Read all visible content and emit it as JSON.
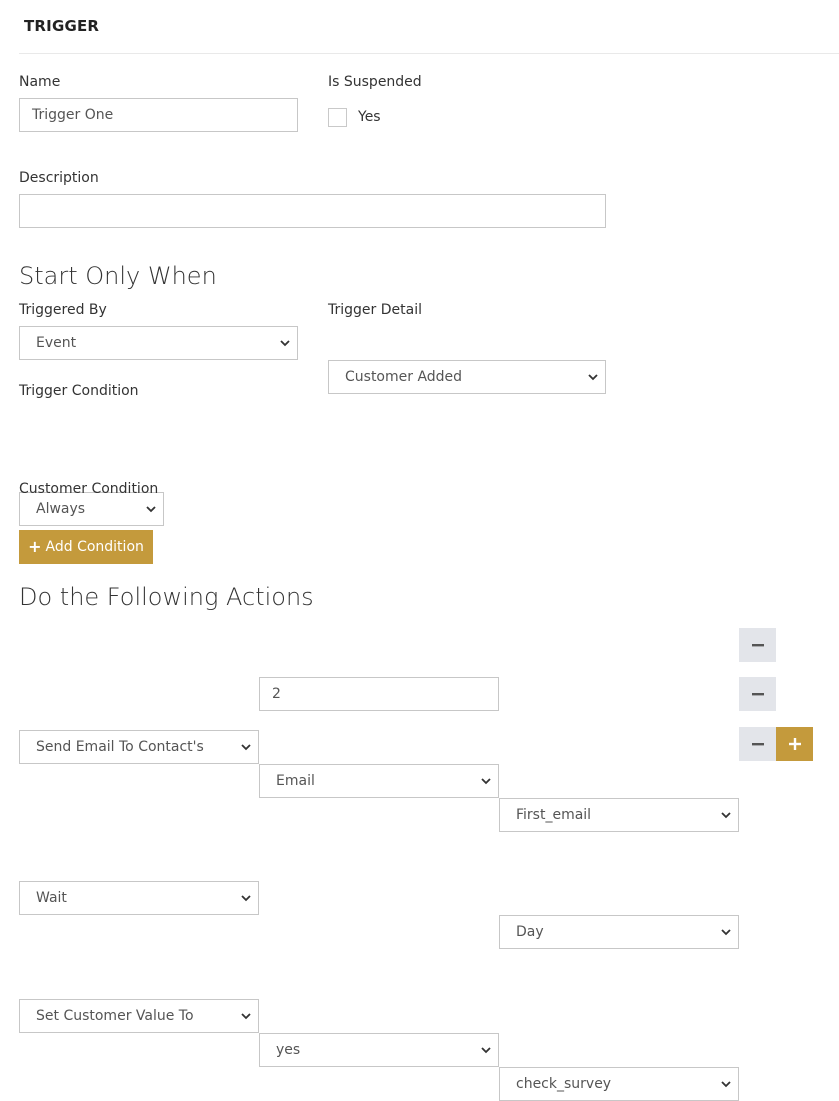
{
  "section": {
    "title": "TRIGGER"
  },
  "name": {
    "label": "Name",
    "value": "Trigger One"
  },
  "suspended": {
    "label": "Is Suspended",
    "checkbox_label": "Yes",
    "checked": false
  },
  "description": {
    "label": "Description",
    "value": ""
  },
  "start_only_when": {
    "heading": "Start Only When",
    "triggered_by": {
      "label": "Triggered By",
      "value": "Event"
    },
    "trigger_detail": {
      "label": "Trigger Detail",
      "value": "Customer Added"
    },
    "trigger_condition": {
      "label": "Trigger Condition",
      "value": "Always"
    },
    "customer_condition": {
      "label": "Customer Condition"
    },
    "add_condition_label": "Add Condition"
  },
  "actions": {
    "heading": "Do the Following Actions",
    "rows": [
      {
        "action": "Send Email To Contact's",
        "field": "Email",
        "value": "First_email"
      },
      {
        "action": "Wait",
        "field": "2",
        "value": "Day"
      },
      {
        "action": "Set Customer Value To",
        "field": "yes",
        "value": "check_survey"
      }
    ]
  },
  "colors": {
    "accent": "#c49a3c",
    "minus_bg": "#e3e5ea",
    "border": "#c7c7c7"
  },
  "icons": {
    "select": "chevron-down-icon",
    "remove": "minus-icon",
    "add": "plus-icon"
  }
}
